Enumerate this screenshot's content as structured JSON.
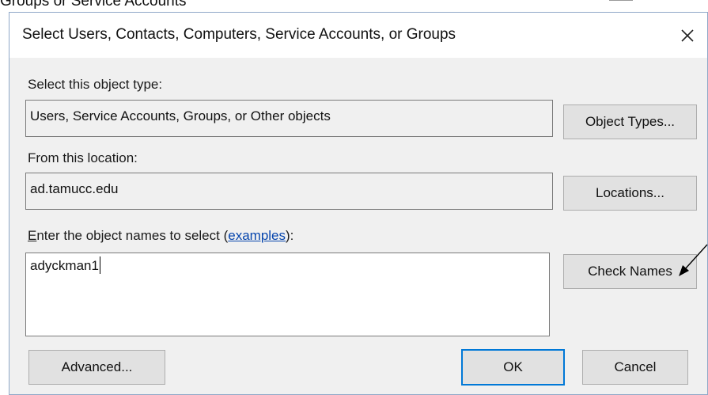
{
  "background": {
    "partial_text": "Groups or Service Accounts"
  },
  "dialog": {
    "title": "Select Users, Contacts, Computers, Service Accounts, or Groups",
    "close_icon": "close-icon",
    "object_type_label": "Select this object type:",
    "object_type_value": "Users, Service Accounts, Groups, or Other objects",
    "object_types_button": "Object Types...",
    "location_label": "From this location:",
    "location_value": "ad.tamucc.edu",
    "locations_button": "Locations...",
    "names_label_accesskey": "E",
    "names_label_rest": "nter the object names to select (",
    "names_label_link": "examples",
    "names_label_end": "):",
    "names_value": "adyckman1",
    "check_names_button": "Check Names",
    "advanced_button": "Advanced...",
    "ok_button": "OK",
    "cancel_button": "Cancel"
  },
  "colors": {
    "dialog_bg": "#f0f0f0",
    "button_bg": "#e1e1e1",
    "default_button_border": "#0078d7",
    "link": "#0645ad"
  },
  "annotation": {
    "icon": "arrow-pointer-icon"
  }
}
